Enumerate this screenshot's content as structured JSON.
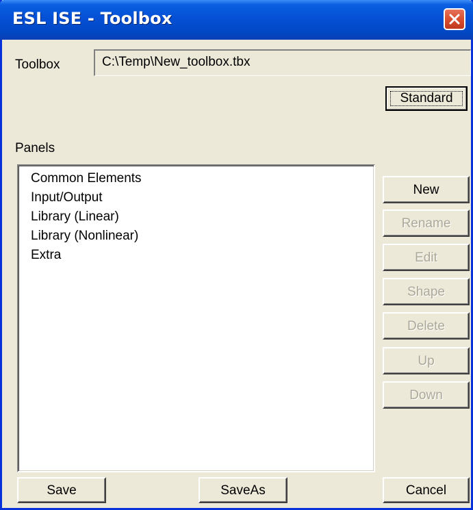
{
  "window": {
    "title": "ESL ISE - Toolbox"
  },
  "toolbox": {
    "label": "Toolbox",
    "path": "C:\\Temp\\New_toolbox.tbx",
    "standard_button": "Standard"
  },
  "panels": {
    "label": "Panels",
    "items": [
      "Common Elements",
      "Input/Output",
      "Library (Linear)",
      "Library (Nonlinear)",
      "Extra"
    ]
  },
  "side_buttons": {
    "new": "New",
    "rename": "Rename",
    "edit": "Edit",
    "shape": "Shape",
    "delete": "Delete",
    "up": "Up",
    "down": "Down"
  },
  "bottom_buttons": {
    "save": "Save",
    "saveas": "SaveAs",
    "cancel": "Cancel"
  },
  "colors": {
    "title_bar": "#0450d6",
    "window_bg": "#ece9d8",
    "close_button": "#d9502f",
    "disabled_text": "#aca899"
  }
}
